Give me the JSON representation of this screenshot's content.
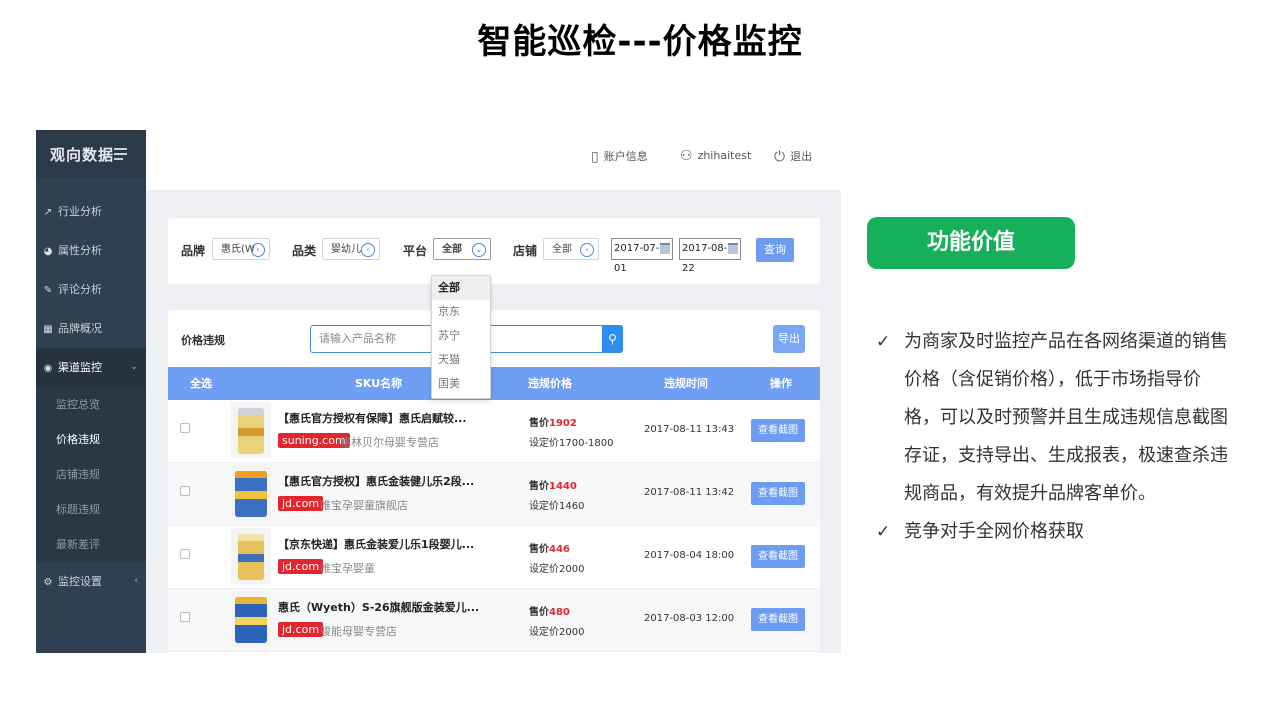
{
  "slide": {
    "title": "智能巡检---价格监控"
  },
  "app": {
    "logo": "观向数据",
    "header": {
      "account_label": "账户信息",
      "user": "zhihaitest",
      "logout_label": "退出"
    },
    "sidebar": {
      "items": [
        {
          "icon": "line-chart-icon",
          "label": "行业分析"
        },
        {
          "icon": "pie-chart-icon",
          "label": "属性分析"
        },
        {
          "icon": "edit-icon",
          "label": "评论分析"
        },
        {
          "icon": "table-icon",
          "label": "品牌概况"
        },
        {
          "icon": "target-icon",
          "label": "渠道监控"
        },
        {
          "icon": "gear-icon",
          "label": "监控设置"
        }
      ],
      "subitems": [
        "监控总览",
        "价格违规",
        "店铺违规",
        "标题违规",
        "最新差评"
      ]
    },
    "filters": {
      "brand_label": "品牌",
      "brand_value": "惠氏(W",
      "category_label": "品类",
      "category_value": "婴幼儿",
      "platform_label": "平台",
      "platform_value": "全部",
      "shop_label": "店铺",
      "shop_value": "全部",
      "date_start": "2017-07-01",
      "date_end": "2017-08-22",
      "query_label": "查询",
      "platform_options": [
        "全部",
        "京东",
        "苏宁",
        "天猫",
        "国美"
      ]
    },
    "table": {
      "title": "价格违规",
      "search_placeholder": "请输入产品名称",
      "export_label": "导出",
      "columns": [
        "全选",
        "SKU名称",
        "违规价格",
        "违规时间",
        "操作"
      ],
      "price_prefix": "售价",
      "action_label": "查看截图",
      "rows": [
        {
          "title": "【惠氏官方授权有保障】惠氏启赋较...",
          "platform": "suning.com",
          "shop": "格林贝尔母婴专营店",
          "price": "1902",
          "set_price": "设定价1700-1800",
          "time": "2017-08-11 13:43"
        },
        {
          "title": "【惠氏官方授权】惠氏金装健儿乐2段...",
          "platform": "jd.com",
          "shop": "唯宝孕婴童旗舰店",
          "price": "1440",
          "set_price": "设定价1460",
          "time": "2017-08-11 13:42"
        },
        {
          "title": "【京东快递】惠氏金装爱儿乐1段婴儿...",
          "platform": "jd.com",
          "shop": "唯宝孕婴童",
          "price": "446",
          "set_price": "设定价2000",
          "time": "2017-08-04 18:00"
        },
        {
          "title": "惠氏（Wyeth）S-26旗舰版金装爱儿...",
          "platform": "jd.com",
          "shop": "骏能母婴专营店",
          "price": "480",
          "set_price": "设定价2000",
          "time": "2017-08-03 12:00"
        }
      ]
    }
  },
  "feature": {
    "badge": "功能价值",
    "bullets": [
      "为商家及时监控产品在各网络渠道的销售价格（含促销价格），低于市场指导价格，可以及时预警并且生成违规信息截图存证，支持导出、生成报表，极速查杀违规商品，有效提升品牌客单价。",
      "竞争对手全网价格获取"
    ]
  },
  "colors": {
    "sidebar": "#2f4050",
    "accent_blue": "#6f9ef5",
    "violation_red": "#e3262d",
    "badge_green": "#16b05b"
  }
}
